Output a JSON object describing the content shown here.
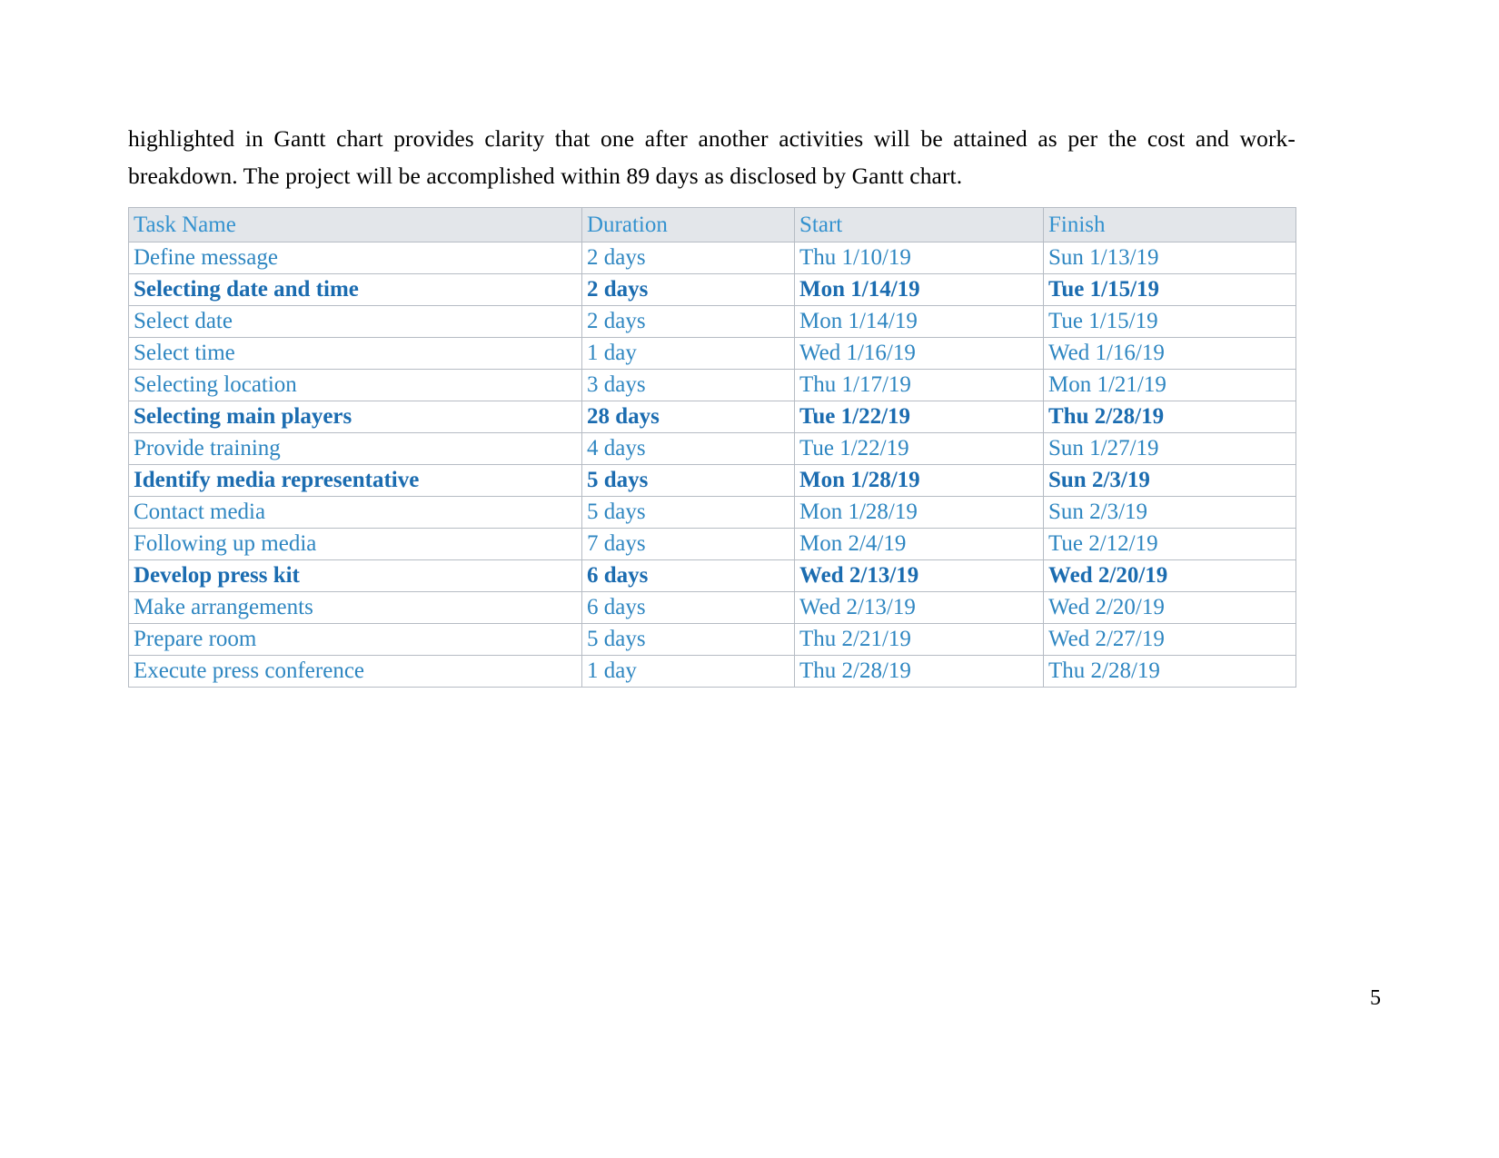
{
  "document": {
    "page_number": "5",
    "paragraph": "highlighted in Gantt chart provides clarity that one after another activities will be attained as per the cost and work-breakdown. The project will be accomplished within 89 days as disclosed by Gantt chart."
  },
  "colors": {
    "header_background": "#e3e6ea",
    "header_text": "#3492cf",
    "row_text": "#2e86c1",
    "summary_row_text": "#1b6cb0",
    "border": "#b6bcc4",
    "body_text": "#000000"
  },
  "table": {
    "headers": [
      "Task Name",
      "Duration",
      "Start",
      "Finish"
    ],
    "rows": [
      {
        "task": "Define message",
        "duration": "2 days",
        "start": "Thu 1/10/19",
        "finish": "Sun 1/13/19",
        "summary": false
      },
      {
        "task": "Selecting date and time",
        "duration": "2 days",
        "start": "Mon 1/14/19",
        "finish": "Tue 1/15/19",
        "summary": true
      },
      {
        "task": "Select date",
        "duration": "2 days",
        "start": "Mon 1/14/19",
        "finish": "Tue 1/15/19",
        "summary": false
      },
      {
        "task": "Select time",
        "duration": "1 day",
        "start": "Wed 1/16/19",
        "finish": "Wed 1/16/19",
        "summary": false
      },
      {
        "task": "Selecting location",
        "duration": "3 days",
        "start": "Thu 1/17/19",
        "finish": "Mon 1/21/19",
        "summary": false
      },
      {
        "task": "Selecting main players",
        "duration": "28 days",
        "start": "Tue 1/22/19",
        "finish": "Thu 2/28/19",
        "summary": true
      },
      {
        "task": "Provide training",
        "duration": "4 days",
        "start": "Tue 1/22/19",
        "finish": "Sun 1/27/19",
        "summary": false
      },
      {
        "task": "Identify media representative",
        "duration": "5 days",
        "start": "Mon 1/28/19",
        "finish": "Sun 2/3/19",
        "summary": true
      },
      {
        "task": "Contact media",
        "duration": "5 days",
        "start": "Mon 1/28/19",
        "finish": "Sun 2/3/19",
        "summary": false
      },
      {
        "task": "Following up media",
        "duration": "7 days",
        "start": "Mon 2/4/19",
        "finish": "Tue 2/12/19",
        "summary": false
      },
      {
        "task": "Develop press kit",
        "duration": "6 days",
        "start": "Wed 2/13/19",
        "finish": "Wed 2/20/19",
        "summary": true
      },
      {
        "task": "Make arrangements",
        "duration": "6 days",
        "start": "Wed 2/13/19",
        "finish": "Wed 2/20/19",
        "summary": false
      },
      {
        "task": "Prepare room",
        "duration": "5 days",
        "start": "Thu 2/21/19",
        "finish": "Wed 2/27/19",
        "summary": false
      },
      {
        "task": "Execute press conference",
        "duration": "1 day",
        "start": "Thu 2/28/19",
        "finish": "Thu 2/28/19",
        "summary": false
      }
    ]
  }
}
